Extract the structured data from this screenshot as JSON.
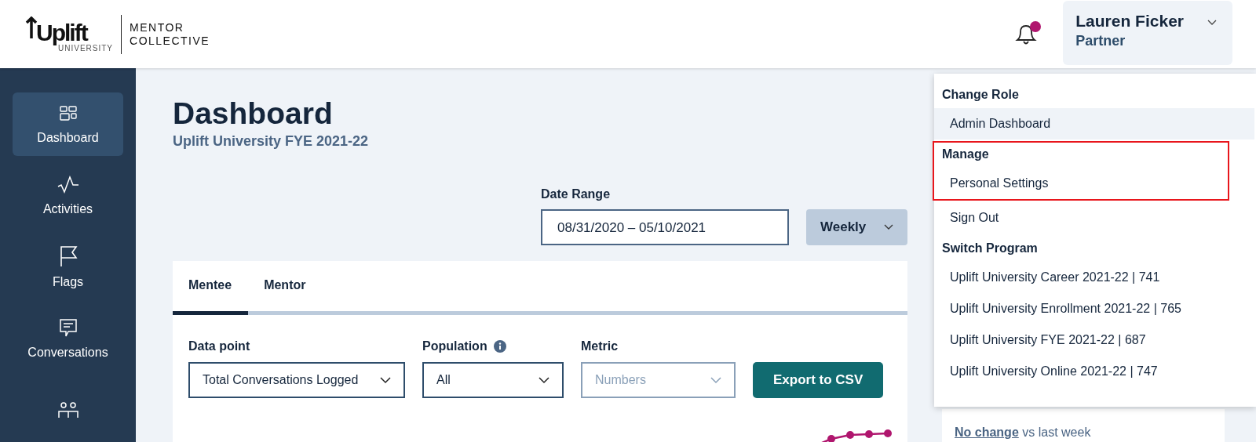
{
  "logo": {
    "wordmark": "Uplift",
    "sub": "UNIVERSITY",
    "partner_line_1": "MENTOR",
    "partner_line_2": "COLLECTIVE"
  },
  "header": {
    "has_notification": true,
    "user_name": "Lauren Ficker",
    "user_role": "Partner"
  },
  "sidebar": {
    "items": [
      {
        "label": "Dashboard",
        "kind": "grid",
        "selected": true
      },
      {
        "label": "Activities",
        "kind": "pulse",
        "selected": false
      },
      {
        "label": "Flags",
        "kind": "flag",
        "selected": false
      },
      {
        "label": "Conversations",
        "kind": "chat",
        "selected": false
      },
      {
        "kind": "people",
        "selected": false
      }
    ]
  },
  "page": {
    "title": "Dashboard",
    "subtitle": "Uplift University FYE 2021-22"
  },
  "date_range": {
    "label": "Date Range",
    "value": "08/31/2020 – 05/10/2021",
    "interval": "Weekly"
  },
  "tabs": [
    {
      "label": "Mentee",
      "selected": true
    },
    {
      "label": "Mentor",
      "selected": false
    }
  ],
  "filters": [
    {
      "label": "Data point",
      "value": "Total Conversations Logged",
      "info": false,
      "disabled": false
    },
    {
      "label": "Population",
      "value": "All",
      "info": true,
      "disabled": false
    },
    {
      "label": "Metric",
      "value": "Numbers",
      "info": false,
      "disabled": true
    }
  ],
  "export_button": "Export to CSV",
  "stat_card": {
    "note_bold": "No change",
    "note_rest": " vs last week"
  },
  "user_menu": {
    "groups": [
      {
        "heading": "Change Role",
        "highlighted": false,
        "items": [
          {
            "label": "Admin Dashboard",
            "selected": true
          }
        ]
      },
      {
        "heading": "Manage",
        "highlighted": true,
        "items": [
          {
            "label": "Personal Settings",
            "selected": false
          }
        ]
      },
      {
        "highlighted": false,
        "items": [
          {
            "label": "Sign Out",
            "selected": false
          }
        ]
      },
      {
        "heading": "Switch Program",
        "highlighted": false,
        "items": [
          {
            "label": "Uplift University Career 2021-22 | 741",
            "selected": false
          },
          {
            "label": "Uplift University Enrollment 2021-22 | 765",
            "selected": false
          },
          {
            "label": "Uplift University FYE 2021-22 | 687",
            "selected": false
          },
          {
            "label": "Uplift University Online 2021-22 | 747",
            "selected": false
          }
        ]
      }
    ]
  }
}
